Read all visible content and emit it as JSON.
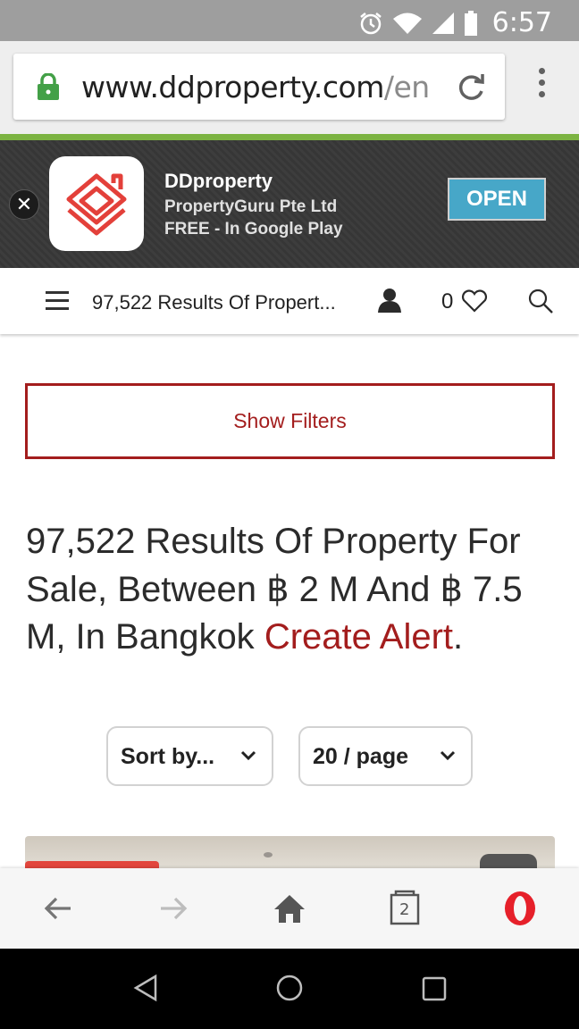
{
  "status_bar": {
    "time": "6:57"
  },
  "browser": {
    "url_main": "www.ddproperty.com",
    "url_rest": "/en",
    "tab_count": "2"
  },
  "app_banner": {
    "app_name": "DDproperty",
    "vendor": "PropertyGuru Pte Ltd",
    "store_text": "FREE - In Google Play",
    "open_label": "OPEN"
  },
  "header": {
    "title": "97,522 Results Of Propert...",
    "favorites_count": "0"
  },
  "filters": {
    "show_label": "Show Filters"
  },
  "results": {
    "heading": "97,522 Results Of Property For Sale, Between ฿ 2 M And ฿ 7.5 M, In Bangkok",
    "alert_link": "Create Alert",
    "alert_suffix": "."
  },
  "controls": {
    "sort_label": "Sort by...",
    "page_size_label": "20 / page"
  },
  "colors": {
    "brand_red": "#a31d1d",
    "open_button": "#47a7c8",
    "progress_green": "#7cb342"
  }
}
